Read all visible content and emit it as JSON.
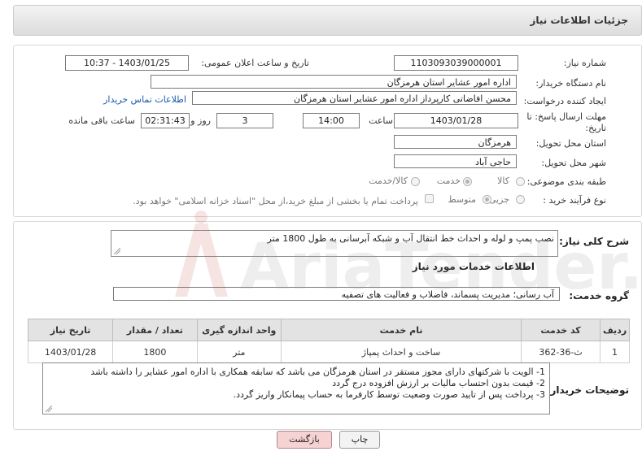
{
  "header": {
    "title": "جزئیات اطلاعات نیاز"
  },
  "form": {
    "need_number": {
      "label": "شماره نیاز:",
      "value": "1103093039000001"
    },
    "announce_datetime": {
      "label": "تاریخ و ساعت اعلان عمومی:",
      "value": "1403/01/25 - 10:37"
    },
    "buyer_org": {
      "label": "نام دستگاه خریدار:",
      "value": "اداره امور عشایر استان هرمزگان"
    },
    "requester": {
      "label": "ایجاد کننده درخواست:",
      "value": "محسن افاضاتی کارپرداز اداره امور عشایر استان هرمزگان",
      "contact_link": "اطلاعات تماس خریدار"
    },
    "deadline": {
      "label_line1": "مهلت ارسال پاسخ: تا",
      "label_line2": "تاریخ:",
      "date": "1403/01/28",
      "time_label": "ساعت",
      "time": "14:00",
      "days": "3",
      "days_label": "روز و",
      "remaining": "02:31:43",
      "remaining_label": "ساعت باقی مانده"
    },
    "province": {
      "label": "استان محل تحویل:",
      "value": "هرمزگان"
    },
    "city": {
      "label": "شهر محل تحویل:",
      "value": "حاجی آباد"
    },
    "category": {
      "label": "طبقه بندی موضوعی:",
      "options": [
        "کالا",
        "خدمت",
        "کالا/خدمت"
      ],
      "selected": "خدمت"
    },
    "process_type": {
      "label": "نوع فرآیند خرید :",
      "options": [
        "جزیی",
        "متوسط"
      ],
      "selected": "متوسط",
      "payment_note": "پرداخت تمام یا بخشی از مبلغ خرید،از محل \"اسناد خزانه اسلامی\" خواهد بود."
    }
  },
  "summary": {
    "label": "شرح کلی نیاز:",
    "value": "نصب پمپ و لوله و احداث خط انتقال آب و شبکه آبرسانی به طول 1800 متر"
  },
  "services": {
    "section_title": "اطلاعات خدمات مورد نیاز",
    "group_label": "گروه خدمت:",
    "group_value": "آب رسانی؛ مدیریت پسماند، فاضلاب و فعالیت های تصفیه",
    "columns": [
      "ردیف",
      "کد خدمت",
      "نام خدمت",
      "واحد اندازه گیری",
      "تعداد / مقدار",
      "تاریخ نیاز"
    ],
    "rows": [
      [
        "1",
        "ث-36-362",
        "ساخت و احداث پمپاژ",
        "متر",
        "1800",
        "1403/01/28"
      ]
    ]
  },
  "buyer_notes": {
    "label": "توضیحات خریدار:",
    "lines": [
      "1- الویت با شرکتهای دارای مجوز مستقر در استان هرمزگان می باشد که سابقه همکاری با اداره امور عشایر را داشته باشد",
      "2- قیمت بدون احتساب مالیات بر ارزش افزوده درج گردد",
      "3- پرداخت پس از تایید صورت وضعیت توسط کارفرما به حساب پیمانکار واریز گردد."
    ]
  },
  "buttons": {
    "print": "چاپ",
    "back": "بازگشت"
  },
  "watermark": {
    "text": "AriaTender.net"
  },
  "colors": {
    "link": "#1a5aa8",
    "back_button_bg": "#f6d2d2",
    "print_button_bg": "#f3f3f3",
    "header_gradient": [
      "#f3f3f3",
      "#dcdcdc"
    ]
  }
}
